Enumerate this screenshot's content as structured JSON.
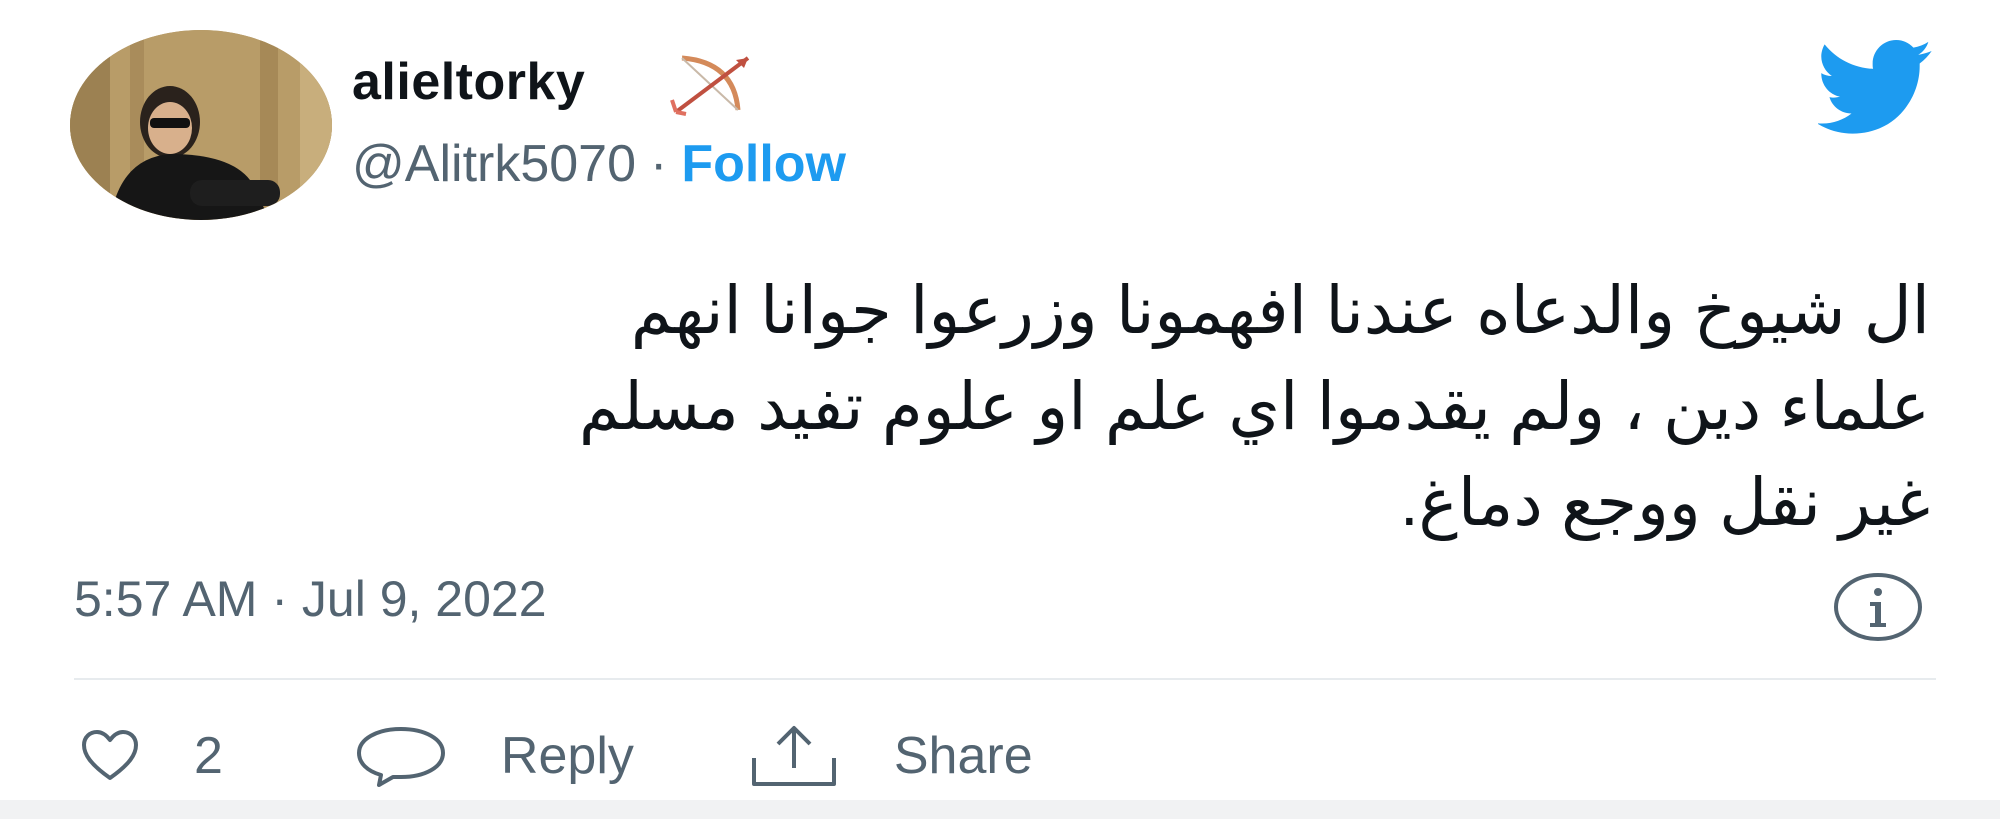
{
  "user": {
    "display_name": "alieltorky",
    "emoji": "bow-and-arrow",
    "handle": "@Alitrk5070",
    "separator": "·",
    "follow_label": "Follow"
  },
  "brand": {
    "icon": "twitter-bird-icon",
    "color": "#1d9bf0"
  },
  "tweet": {
    "text": "ال شيوخ والدعاه عندنا افهمونا وزرعوا جوانا انهم\nعلماء دين ، ولم يقدموا اي علم او علوم تفيد مسلم\nغير نقل  ووجع دماغ."
  },
  "timestamp": "5:57 AM · Jul 9, 2022",
  "actions": {
    "like_count": "2",
    "reply_label": "Reply",
    "share_label": "Share"
  },
  "colors": {
    "text": "#0f1419",
    "secondary": "#536471",
    "accent": "#1d9bf0",
    "divider": "#e7ebee"
  }
}
